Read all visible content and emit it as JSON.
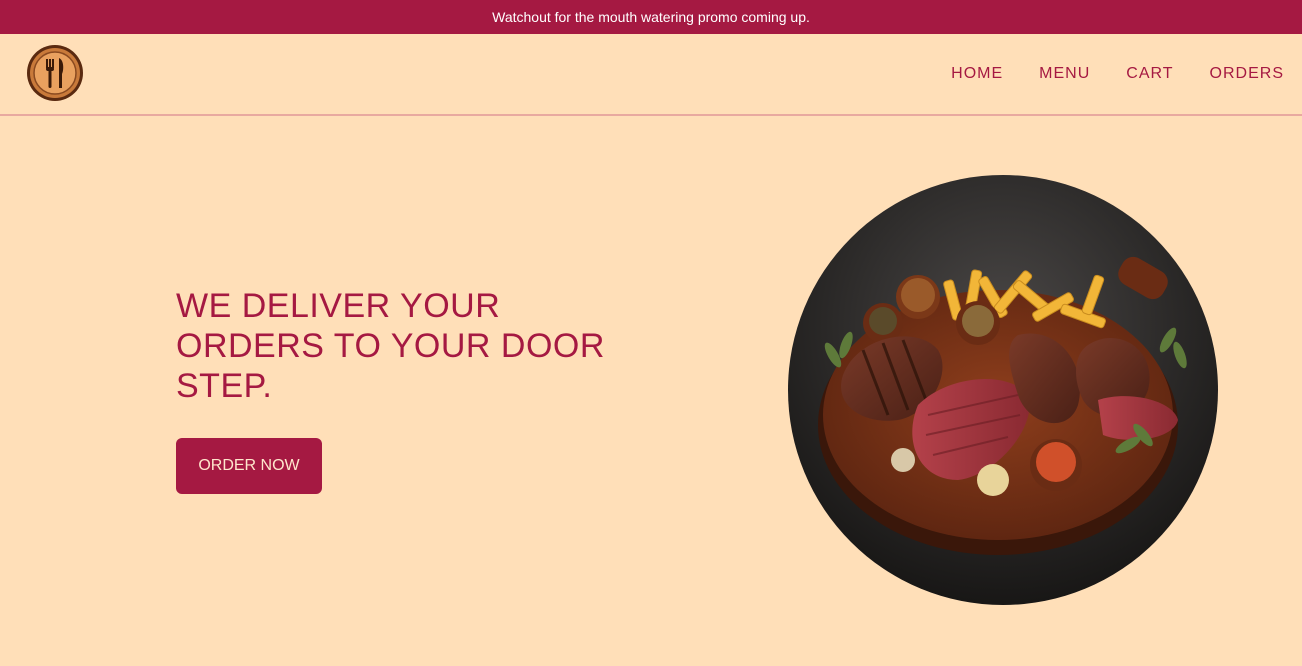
{
  "promo": {
    "text": "Watchout for the mouth watering promo coming up."
  },
  "nav": {
    "logo_icon": "fork-knife-icon",
    "links": [
      "HOME",
      "MENU",
      "CART",
      "ORDERS"
    ]
  },
  "hero": {
    "title": "WE DELIVER YOUR ORDERS TO YOUR DOOR STEP.",
    "cta_label": "ORDER NOW",
    "image": "steak-platter-image"
  },
  "colors": {
    "brand": "#A51942",
    "background": "#FFDFB8",
    "button_text": "#FFE6CC"
  }
}
